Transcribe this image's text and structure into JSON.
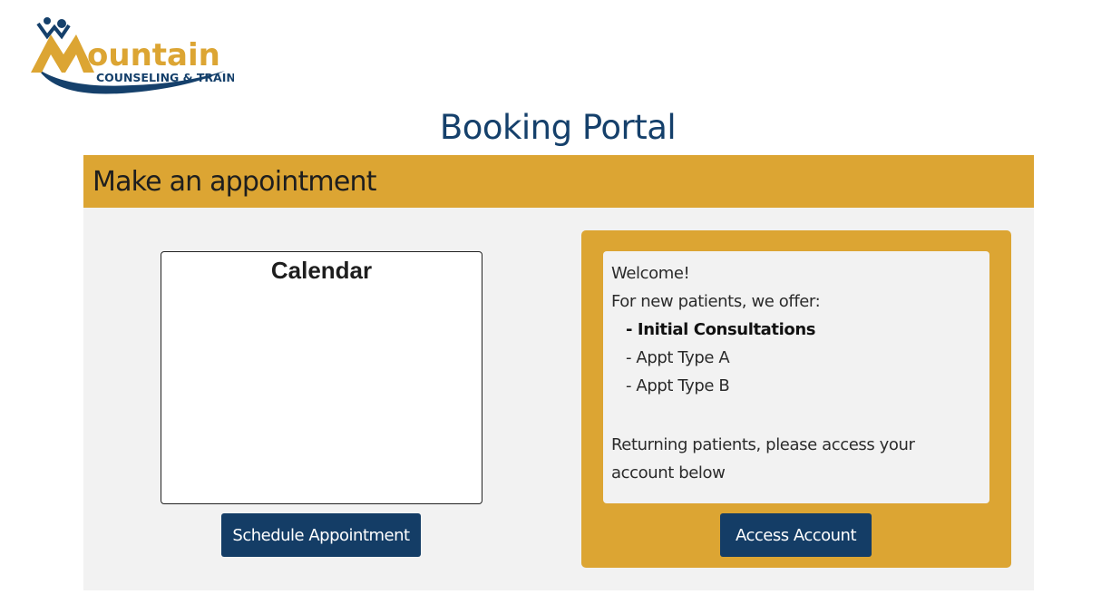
{
  "logo": {
    "word": "ountain",
    "tagline": "COUNSELING & TRAINING",
    "colors": {
      "gold": "#dca533",
      "navy": "#15406b"
    }
  },
  "page_title": "Booking Portal",
  "card": {
    "header": "Make an appointment",
    "calendar_title": "Calendar",
    "schedule_button": "Schedule Appointment",
    "info": {
      "welcome": "Welcome!",
      "offer_intro": "For new patients, we offer:",
      "offers": [
        "- Initial Consultations",
        "- Appt Type A",
        "- Appt Type B"
      ],
      "returning": "Returning patients, please access your account below"
    },
    "access_button": "Access Account"
  },
  "colors": {
    "header_gold": "#dca533",
    "button_navy": "#143d66",
    "title_navy": "#15406b",
    "panel_gray": "#f2f2f2"
  }
}
